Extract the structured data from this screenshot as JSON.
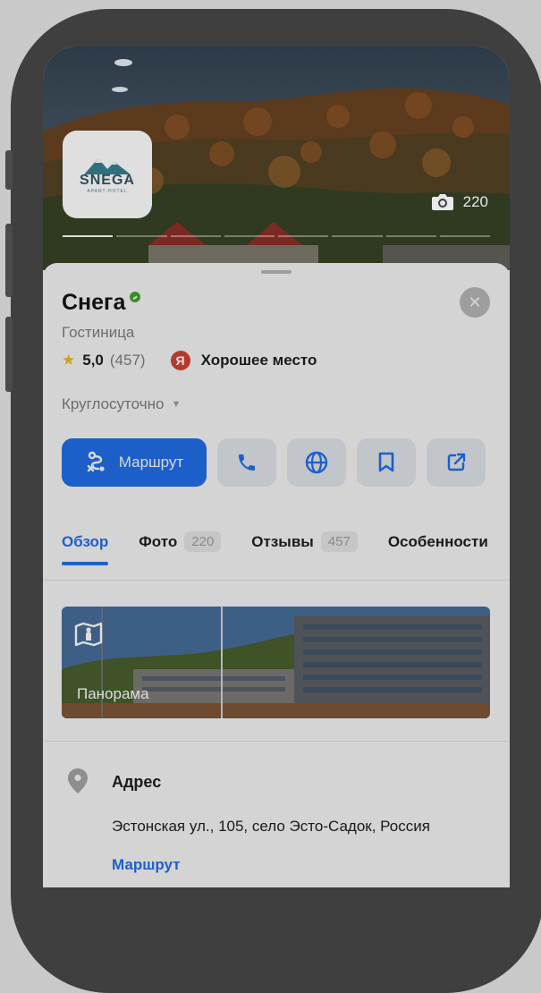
{
  "hotel": {
    "name": "Снега",
    "category": "Гостиница",
    "rating": "5,0",
    "reviews_count": "(457)",
    "badge_letter": "Я",
    "badge_text": "Хорошее место",
    "hours": "Круглосуточно",
    "logo_text": "SNEGA",
    "logo_subtext": "APART-HOTEL"
  },
  "gallery": {
    "photo_count": "220",
    "slides": 8,
    "active_slide": 1
  },
  "actions": {
    "route_label": "Маршрут"
  },
  "tabs": [
    {
      "label": "Обзор",
      "count": ""
    },
    {
      "label": "Фото",
      "count": "220"
    },
    {
      "label": "Отзывы",
      "count": "457"
    },
    {
      "label": "Особенности",
      "count": ""
    }
  ],
  "panorama": {
    "label": "Панорама"
  },
  "address": {
    "title": "Адрес",
    "text": "Эстонская ул., 105, село Эсто-Садок, Россия",
    "route_link": "Маршрут"
  },
  "colors": {
    "accent": "#1d5fc9",
    "verified": "#3a8c2c",
    "star": "#c9a227",
    "badge": "#b5392c"
  }
}
